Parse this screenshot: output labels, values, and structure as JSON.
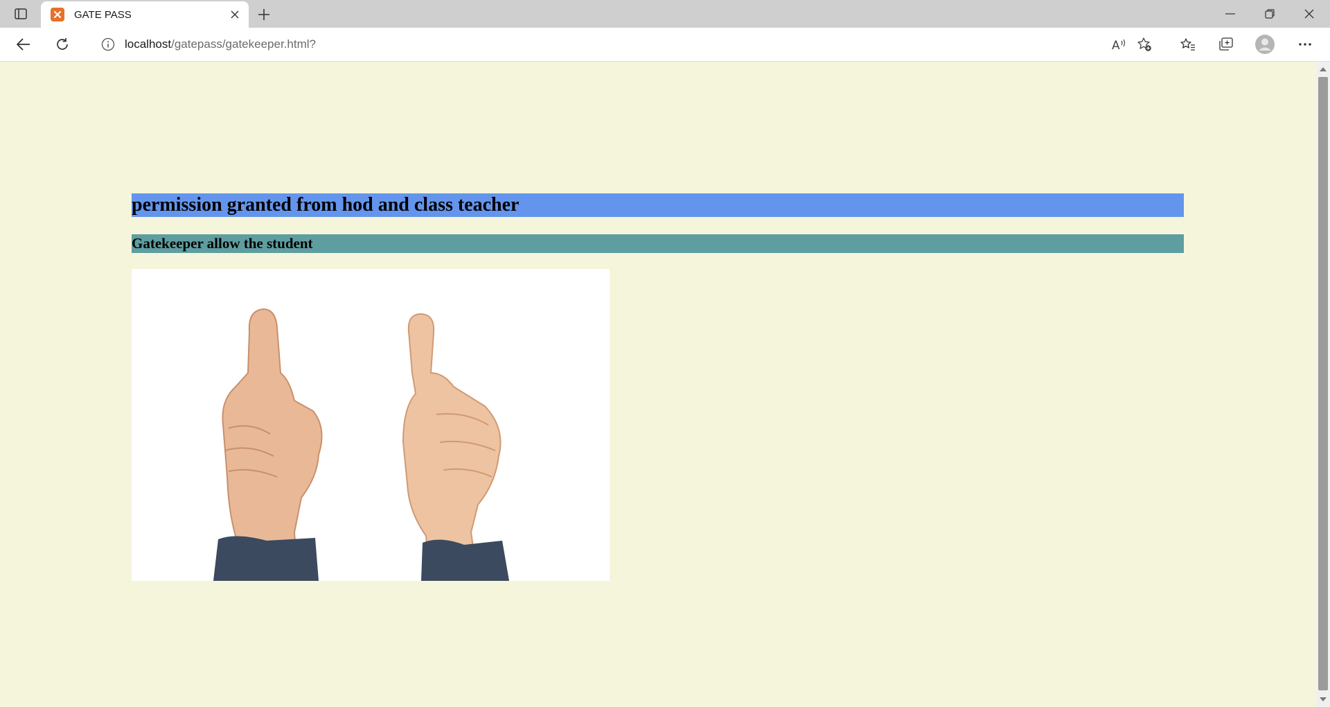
{
  "browser": {
    "tab": {
      "title": "GATE PASS",
      "favicon": "xampp-icon"
    },
    "address": {
      "host": "localhost",
      "path": "/gatepass/gatekeeper.html?"
    },
    "icons": {
      "tab_actions": "tab-actions-icon",
      "close_tab": "close-icon",
      "new_tab": "plus-icon",
      "minimize": "minimize-icon",
      "restore": "restore-icon",
      "close_window": "close-icon",
      "back": "back-arrow-icon",
      "refresh": "refresh-icon",
      "site_info": "info-icon",
      "read_aloud": "read-aloud-icon",
      "add_favorite": "star-add-icon",
      "favorites": "favorites-icon",
      "collections": "collections-icon",
      "profile": "profile-icon",
      "more": "more-icon"
    }
  },
  "page": {
    "heading1": "permission granted from hod and class teacher",
    "heading2": "Gatekeeper allow the student",
    "image_subject": "thumbs-up hands photo",
    "colors": {
      "background": "#f5f5dc",
      "heading1_bg": "#6495ed",
      "heading2_bg": "#5f9ea0"
    }
  }
}
